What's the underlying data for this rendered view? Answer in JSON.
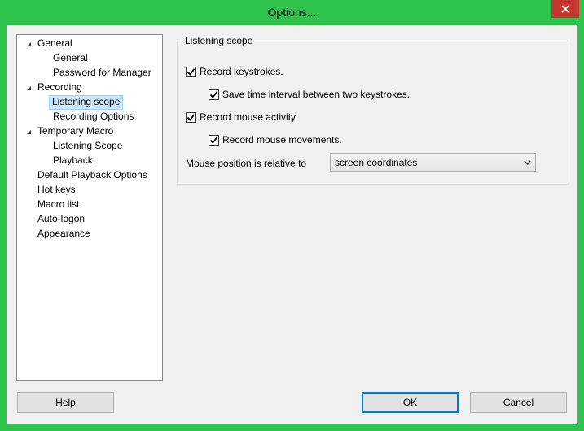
{
  "window": {
    "title": "Options..."
  },
  "tree": {
    "items": [
      {
        "label": "General",
        "expandable": true
      },
      {
        "label": "General"
      },
      {
        "label": "Password for Manager"
      },
      {
        "label": "Recording",
        "expandable": true
      },
      {
        "label": "Listening scope",
        "selected": true
      },
      {
        "label": "Recording Options"
      },
      {
        "label": "Temporary Macro",
        "expandable": true
      },
      {
        "label": "Listening Scope"
      },
      {
        "label": "Playback"
      },
      {
        "label": "Default Playback Options"
      },
      {
        "label": "Hot keys"
      },
      {
        "label": "Macro list"
      },
      {
        "label": "Auto-logon"
      },
      {
        "label": "Appearance"
      }
    ]
  },
  "panel": {
    "group_title": "Listening scope",
    "checkboxes": [
      {
        "label": "Record keystrokes.",
        "checked": true
      },
      {
        "label": "Save time interval between two keystrokes.",
        "checked": true
      },
      {
        "label": "Record mouse activity",
        "checked": true
      },
      {
        "label": "Record mouse movements.",
        "checked": true
      }
    ],
    "mouse_position": {
      "label": "Mouse position is relative to",
      "value": "screen coordinates"
    }
  },
  "buttons": {
    "help": "Help",
    "ok": "OK",
    "cancel": "Cancel"
  },
  "colors": {
    "window_border": "#2fc34c",
    "close_button": "#c7372f",
    "selection": "#cce8ff"
  }
}
